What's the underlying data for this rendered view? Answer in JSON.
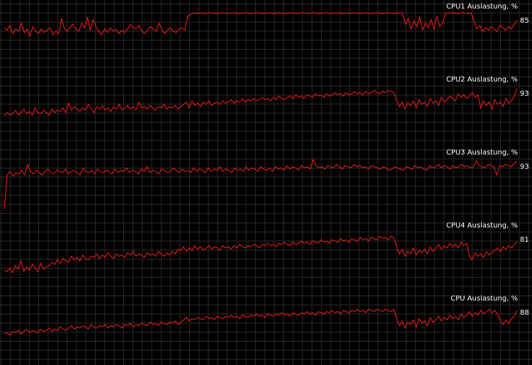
{
  "colors": {
    "background": "#000000",
    "grid": "#2c2c2c",
    "line": "#ff1a1a",
    "text": "#ffffff"
  },
  "grid": true,
  "chart_data": [
    {
      "type": "line",
      "title": "CPU1 Auslastung, %",
      "current_value": "85",
      "ylim": [
        0,
        100
      ],
      "series": [
        {
          "values": [
            72,
            68,
            76,
            62,
            70,
            66,
            80,
            64,
            70,
            58,
            74,
            66,
            62,
            70,
            64,
            68,
            72,
            60,
            66,
            62,
            88,
            70,
            66,
            74,
            78,
            70,
            66,
            80,
            72,
            90,
            68,
            86,
            74,
            66,
            60,
            70,
            64,
            72,
            66,
            70,
            62,
            68,
            64,
            70,
            78,
            72,
            70,
            76,
            66,
            62,
            68,
            74,
            70,
            66,
            80,
            70,
            62,
            68,
            72,
            66,
            64,
            70,
            72,
            68,
            92,
            95,
            97,
            96,
            97,
            98,
            96,
            97,
            98,
            97,
            96,
            97,
            98,
            97,
            96,
            97,
            98,
            97,
            96,
            97,
            98,
            97,
            96,
            97,
            98,
            97,
            96,
            97,
            97,
            98,
            96,
            97,
            98,
            97,
            96,
            97,
            98,
            97,
            96,
            97,
            98,
            97,
            96,
            97,
            98,
            97,
            96,
            97,
            98,
            97,
            96,
            97,
            98,
            97,
            96,
            97,
            97,
            96,
            98,
            97,
            96,
            97,
            98,
            97,
            96,
            97,
            98,
            97,
            96,
            97,
            98,
            97,
            96,
            97,
            98,
            97,
            78,
            88,
            70,
            84,
            74,
            90,
            68,
            80,
            72,
            86,
            70,
            92,
            74,
            80,
            96,
            97,
            98,
            97,
            96,
            97,
            98,
            97,
            96,
            97,
            82,
            70,
            76,
            66,
            72,
            68,
            74,
            70,
            66,
            76,
            72,
            68,
            74,
            70,
            78,
            85
          ]
        }
      ]
    },
    {
      "type": "line",
      "title": "CPU2 Auslastung, %",
      "current_value": "93",
      "ylim": [
        0,
        100
      ],
      "series": [
        {
          "values": [
            46,
            52,
            48,
            50,
            56,
            48,
            52,
            58,
            50,
            54,
            48,
            60,
            52,
            50,
            56,
            52,
            48,
            58,
            52,
            56,
            54,
            60,
            52,
            68,
            56,
            62,
            58,
            54,
            60,
            56,
            66,
            58,
            52,
            62,
            58,
            64,
            56,
            60,
            54,
            62,
            58,
            66,
            56,
            60,
            64,
            58,
            62,
            56,
            70,
            60,
            62,
            58,
            64,
            60,
            56,
            62,
            60,
            66,
            58,
            62,
            60,
            64,
            58,
            62,
            66,
            70,
            60,
            72,
            64,
            68,
            62,
            70,
            66,
            72,
            64,
            68,
            70,
            66,
            72,
            68,
            70,
            74,
            68,
            72,
            70,
            76,
            70,
            74,
            72,
            76,
            72,
            74,
            78,
            74,
            76,
            72,
            78,
            74,
            80,
            76,
            74,
            78,
            80,
            76,
            82,
            78,
            80,
            76,
            82,
            80,
            78,
            84,
            80,
            82,
            78,
            84,
            80,
            82,
            86,
            82,
            84,
            80,
            86,
            82,
            84,
            88,
            84,
            86,
            82,
            88,
            84,
            86,
            90,
            86,
            84,
            88,
            86,
            90,
            88,
            86,
            72,
            62,
            70,
            58,
            68,
            64,
            72,
            60,
            74,
            66,
            70,
            62,
            76,
            68,
            72,
            64,
            78,
            70,
            74,
            80,
            76,
            72,
            84,
            78,
            82,
            76,
            80,
            86,
            78,
            82,
            60,
            72,
            64,
            70,
            58,
            74,
            66,
            70,
            62,
            76,
            68,
            72,
            80,
            93
          ]
        }
      ]
    },
    {
      "type": "line",
      "title": "CPU3 Auslastung, %",
      "current_value": "93",
      "ylim": [
        0,
        100
      ],
      "series": [
        {
          "values": [
            12,
            70,
            76,
            68,
            74,
            72,
            78,
            70,
            88,
            76,
            72,
            78,
            74,
            70,
            76,
            80,
            74,
            72,
            78,
            76,
            74,
            80,
            72,
            76,
            78,
            74,
            70,
            82,
            76,
            74,
            78,
            72,
            80,
            76,
            74,
            78,
            76,
            72,
            80,
            74,
            78,
            76,
            82,
            74,
            78,
            76,
            72,
            80,
            76,
            84,
            74,
            78,
            76,
            72,
            80,
            78,
            74,
            76,
            82,
            78,
            74,
            80,
            76,
            78,
            74,
            82,
            76,
            80,
            78,
            74,
            82,
            76,
            80,
            78,
            84,
            76,
            80,
            78,
            74,
            82,
            78,
            80,
            76,
            84,
            78,
            82,
            80,
            76,
            84,
            80,
            78,
            82,
            76,
            84,
            80,
            82,
            78,
            86,
            80,
            84,
            82,
            78,
            86,
            82,
            84,
            80,
            96,
            86,
            82,
            84,
            80,
            86,
            84,
            82,
            88,
            84,
            80,
            86,
            84,
            82,
            88,
            84,
            86,
            82,
            84,
            80,
            86,
            84,
            82,
            80,
            84,
            82,
            78,
            80,
            84,
            82,
            80,
            78,
            84,
            82,
            80,
            86,
            82,
            84,
            80,
            78,
            86,
            82,
            84,
            88,
            82,
            86,
            84,
            80,
            86,
            82,
            84,
            88,
            84,
            86,
            82,
            84,
            94,
            86,
            84,
            82,
            88,
            86,
            84,
            70,
            86,
            84,
            88,
            86,
            84,
            90,
            93
          ]
        }
      ]
    },
    {
      "type": "line",
      "title": "CPU4 Auslastung, %",
      "current_value": "81",
      "ylim": [
        0,
        100
      ],
      "series": [
        {
          "values": [
            32,
            30,
            36,
            28,
            40,
            34,
            48,
            30,
            38,
            32,
            42,
            36,
            30,
            44,
            34,
            38,
            40,
            46,
            42,
            50,
            44,
            52,
            48,
            46,
            56,
            50,
            54,
            48,
            58,
            52,
            50,
            56,
            54,
            60,
            52,
            58,
            54,
            62,
            56,
            52,
            60,
            56,
            58,
            54,
            62,
            58,
            64,
            56,
            60,
            58,
            54,
            62,
            58,
            60,
            56,
            64,
            60,
            56,
            62,
            58,
            64,
            60,
            68,
            66,
            72,
            64,
            70,
            66,
            74,
            68,
            72,
            66,
            70,
            74,
            68,
            72,
            70,
            66,
            74,
            70,
            72,
            68,
            74,
            70,
            76,
            72,
            70,
            74,
            72,
            76,
            74,
            70,
            76,
            74,
            78,
            74,
            76,
            72,
            78,
            76,
            80,
            76,
            74,
            80,
            76,
            78,
            82,
            78,
            80,
            76,
            82,
            80,
            78,
            84,
            80,
            82,
            78,
            84,
            82,
            80,
            86,
            82,
            84,
            80,
            86,
            84,
            82,
            88,
            84,
            86,
            82,
            88,
            86,
            84,
            90,
            86,
            88,
            84,
            90,
            88,
            72,
            60,
            68,
            56,
            64,
            60,
            70,
            58,
            66,
            62,
            68,
            60,
            72,
            64,
            70,
            76,
            68,
            74,
            70,
            78,
            72,
            76,
            70,
            80,
            74,
            78,
            56,
            50,
            62,
            56,
            60,
            54,
            64,
            58,
            62,
            66,
            70,
            64,
            72,
            68,
            74,
            70,
            76,
            81
          ]
        }
      ]
    },
    {
      "type": "line",
      "title": "CPU Auslastung, %",
      "current_value": "88",
      "ylim": [
        0,
        100
      ],
      "series": [
        {
          "values": [
            48,
            50,
            46,
            52,
            50,
            54,
            48,
            52,
            56,
            50,
            54,
            52,
            50,
            56,
            52,
            54,
            58,
            52,
            56,
            54,
            60,
            56,
            54,
            58,
            62,
            56,
            60,
            58,
            62,
            60,
            56,
            64,
            60,
            58,
            62,
            60,
            64,
            58,
            62,
            60,
            64,
            62,
            58,
            64,
            62,
            66,
            60,
            64,
            62,
            66,
            64,
            62,
            68,
            64,
            66,
            62,
            68,
            66,
            64,
            68,
            66,
            70,
            64,
            68,
            72,
            76,
            70,
            74,
            72,
            76,
            74,
            72,
            78,
            74,
            76,
            72,
            78,
            76,
            74,
            78,
            76,
            80,
            76,
            78,
            74,
            80,
            78,
            76,
            80,
            78,
            82,
            78,
            80,
            76,
            82,
            80,
            78,
            82,
            80,
            84,
            80,
            82,
            78,
            84,
            82,
            80,
            84,
            82,
            86,
            82,
            84,
            80,
            86,
            84,
            82,
            86,
            84,
            88,
            84,
            86,
            82,
            88,
            86,
            84,
            88,
            86,
            90,
            86,
            88,
            84,
            90,
            88,
            86,
            90,
            88,
            86,
            90,
            88,
            86,
            90,
            74,
            62,
            70,
            58,
            68,
            64,
            72,
            60,
            74,
            66,
            70,
            62,
            76,
            68,
            72,
            78,
            70,
            76,
            72,
            80,
            74,
            78,
            72,
            82,
            76,
            80,
            86,
            78,
            84,
            80,
            88,
            82,
            86,
            90,
            84,
            88,
            82,
            70,
            64,
            72,
            66,
            74,
            78,
            88
          ]
        }
      ]
    }
  ]
}
